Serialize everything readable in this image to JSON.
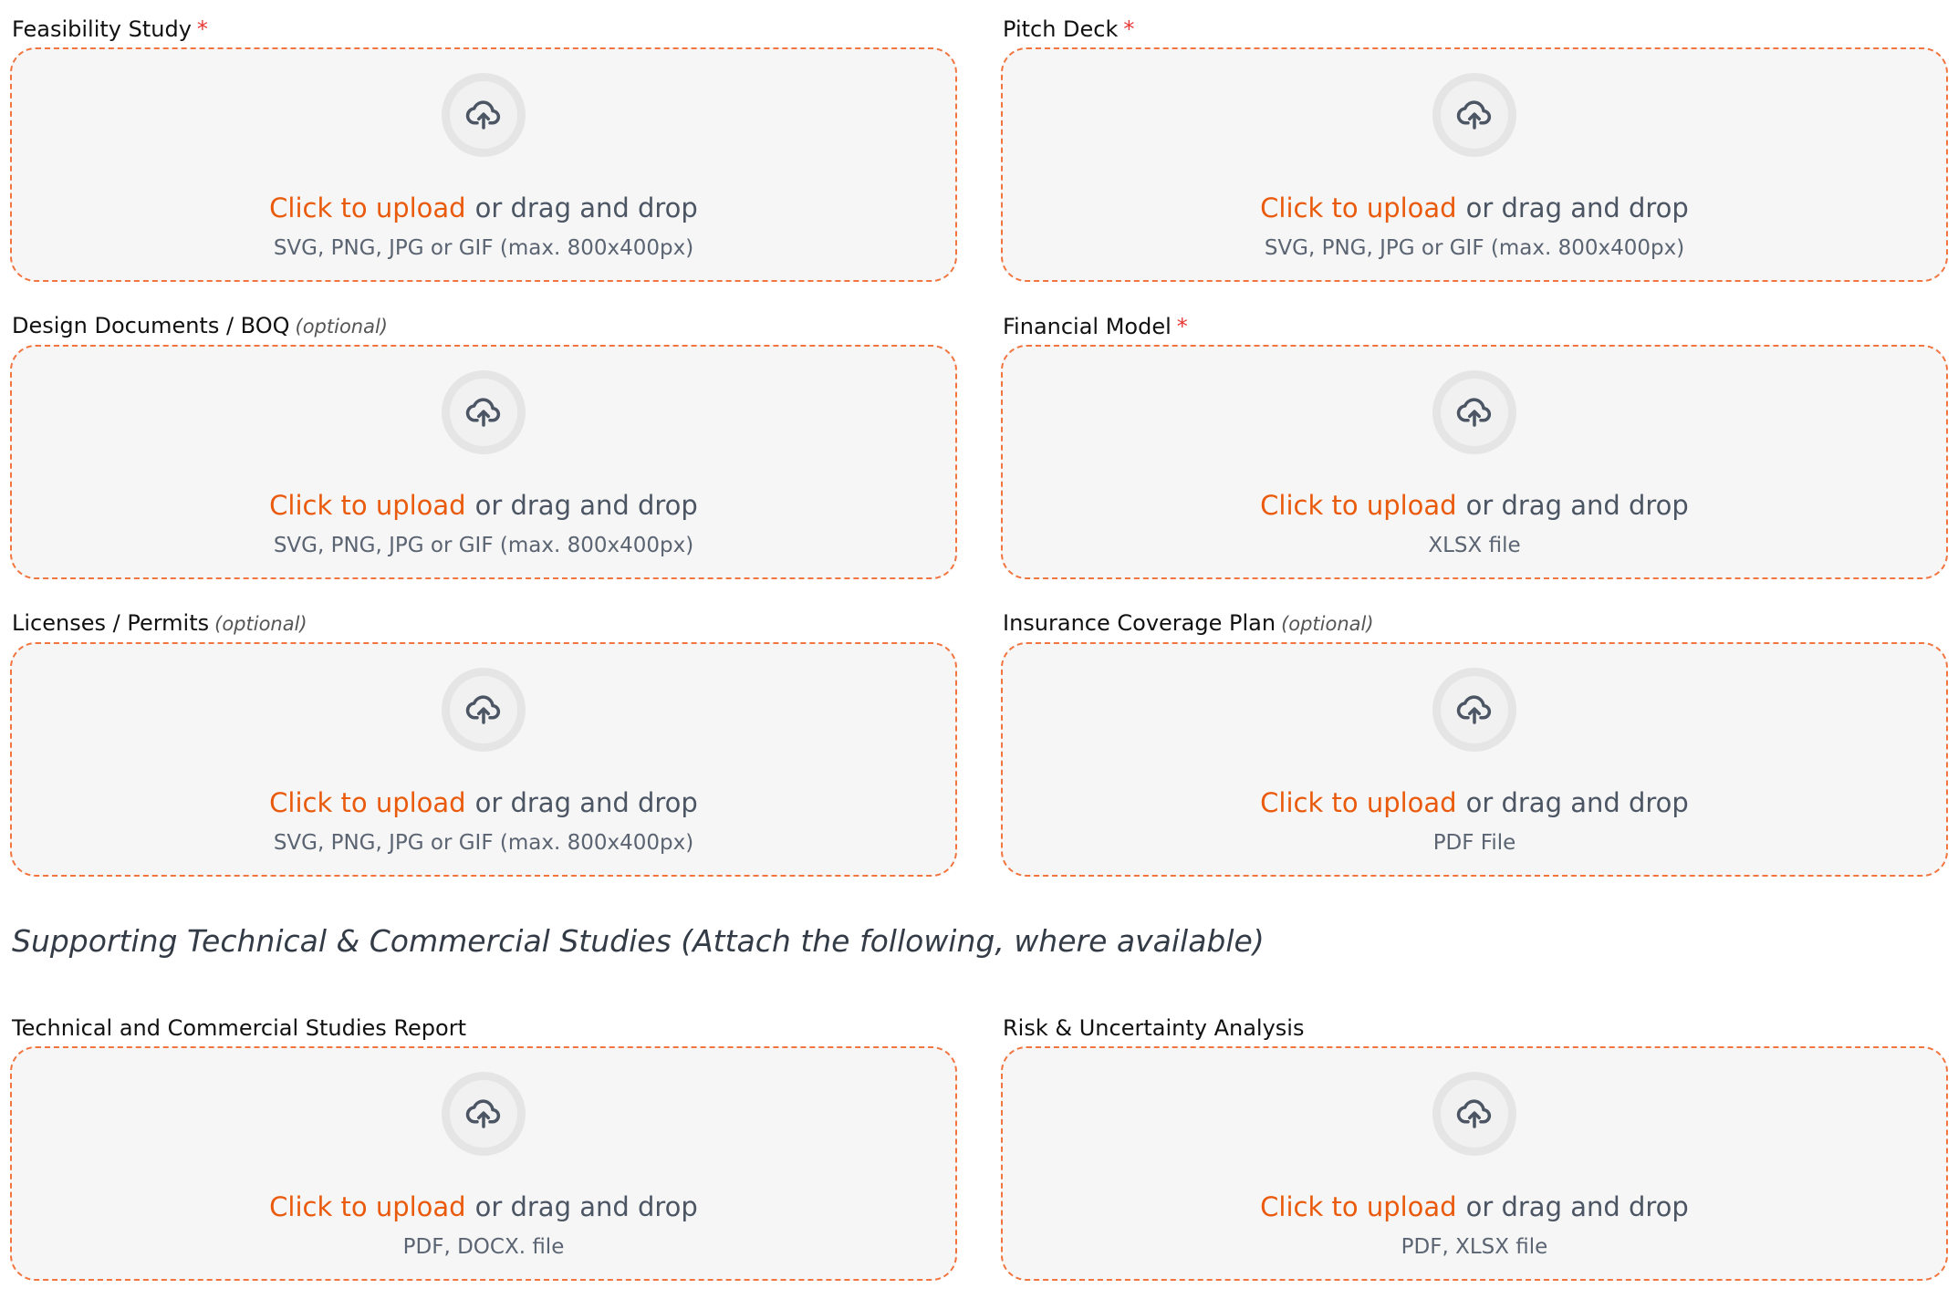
{
  "uploads_top": [
    {
      "label": "Feasibility Study",
      "required": "*",
      "optional": "",
      "cta": "Click to upload",
      "rest": "or drag and drop",
      "hint": "SVG, PNG, JPG or GIF (max. 800x400px)"
    },
    {
      "label": "Pitch Deck",
      "required": "*",
      "optional": "",
      "cta": "Click to upload",
      "rest": "or drag and drop",
      "hint": "SVG, PNG, JPG or GIF (max. 800x400px)"
    },
    {
      "label": "Design Documents / BOQ",
      "required": "",
      "optional": "(optional)",
      "cta": "Click to upload",
      "rest": "or drag and drop",
      "hint": "SVG, PNG, JPG or GIF (max. 800x400px)"
    },
    {
      "label": "Financial Model",
      "required": "*",
      "optional": "",
      "cta": "Click to upload",
      "rest": "or drag and drop",
      "hint": "XLSX file"
    },
    {
      "label": "Licenses / Permits",
      "required": "",
      "optional": "(optional)",
      "cta": "Click to upload",
      "rest": "or drag and drop",
      "hint": "SVG, PNG, JPG or GIF (max. 800x400px)"
    },
    {
      "label": "Insurance Coverage Plan",
      "required": "",
      "optional": "(optional)",
      "cta": "Click to upload",
      "rest": "or drag and drop",
      "hint": "PDF File"
    }
  ],
  "section_title": "Supporting Technical & Commercial Studies (Attach the following, where available)",
  "uploads_bottom": [
    {
      "label": "Technical and Commercial Studies Report",
      "required": "",
      "optional": "",
      "cta": "Click to upload",
      "rest": "or drag and drop",
      "hint": "PDF, DOCX. file"
    },
    {
      "label": "Risk & Uncertainty Analysis",
      "required": "",
      "optional": "",
      "cta": "Click to upload",
      "rest": "or drag and drop",
      "hint": "PDF, XLSX file"
    }
  ],
  "icons": {
    "upload": "cloud-upload-icon"
  },
  "colors": {
    "accent": "#ea5a0c",
    "border": "#f2743f",
    "required": "#e53935"
  }
}
